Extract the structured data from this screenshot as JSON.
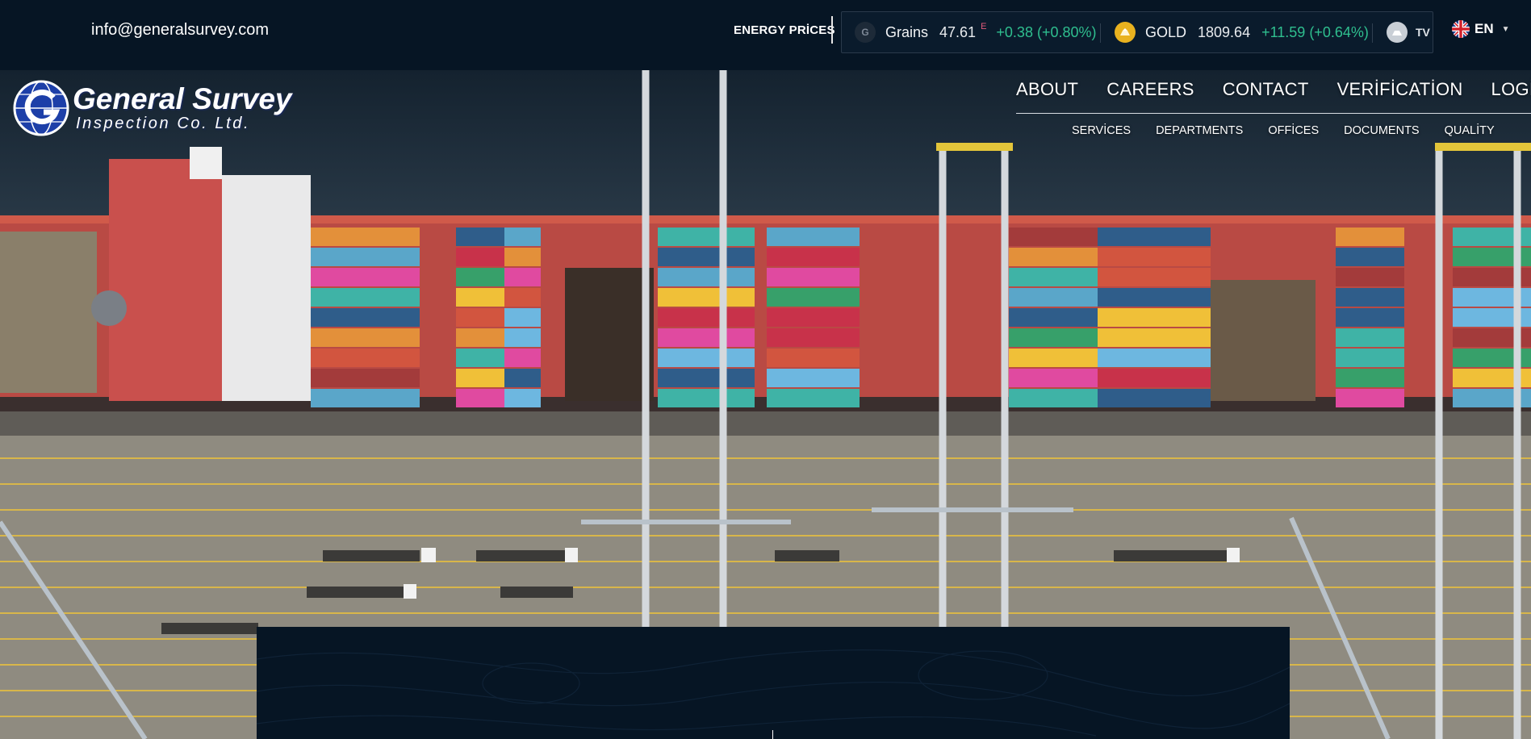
{
  "topbar": {
    "email": "info@generalsurvey.com",
    "energy_label": "ENERGY PRİCES",
    "ticker": [
      {
        "logo": "G",
        "name": "Grains",
        "price": "47.61",
        "sup": "E",
        "change": "+0.38 (+0.80%)"
      },
      {
        "logo": "gold-coin-icon",
        "name": "GOLD",
        "price": "1809.64",
        "change": "+11.59 (+0.64%)"
      }
    ],
    "tv_logo": "TV",
    "language": "EN"
  },
  "brand": {
    "title": "General Survey",
    "subtitle": "Inspection Co. Ltd."
  },
  "main_nav": [
    "ABOUT",
    "CAREERS",
    "CONTACT",
    "VERİFİCATİON",
    "LOGİN"
  ],
  "sub_nav": [
    "SERVİCES",
    "DEPARTMENTS",
    "OFFİCES",
    "DOCUMENTS",
    "QUALİTY"
  ],
  "colors": {
    "topbar_bg": "#061524",
    "ticker_up": "#2fbf8f",
    "ship_red": "#c0504a",
    "water": "#1f3040"
  }
}
